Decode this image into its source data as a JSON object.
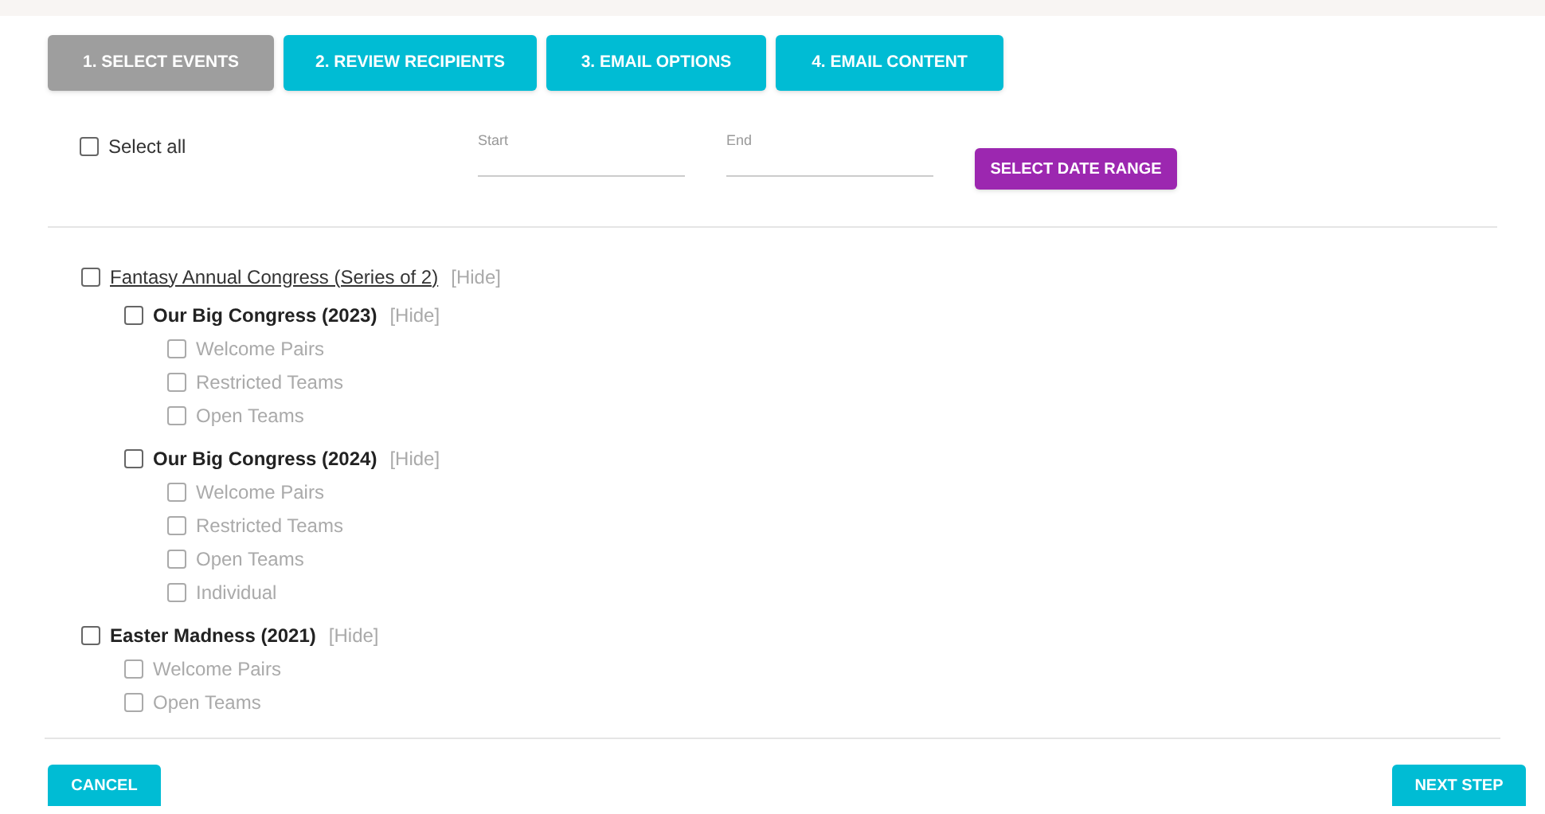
{
  "tabs": [
    {
      "label": "1. SELECT EVENTS",
      "selected": true
    },
    {
      "label": "2. REVIEW RECIPIENTS",
      "selected": false
    },
    {
      "label": "3. EMAIL OPTIONS",
      "selected": false
    },
    {
      "label": "4. EMAIL CONTENT",
      "selected": false
    }
  ],
  "select_all": {
    "label": "Select all",
    "checked": false
  },
  "date_fields": [
    {
      "placeholder": "Start"
    },
    {
      "placeholder": "End"
    }
  ],
  "date_range_button": "SELECT DATE RANGE",
  "events": [
    {
      "kind": "series",
      "label": "Fantasy Annual Congress (Series of 2)",
      "checked": false,
      "hide": "[Hide]",
      "children": [
        {
          "kind": "event",
          "label": "Our Big Congress (2023)",
          "checked": false,
          "hide": "[Hide]",
          "children": [
            {
              "kind": "session",
              "label": "Welcome Pairs",
              "checked": false
            },
            {
              "kind": "session",
              "label": "Restricted Teams",
              "checked": false
            },
            {
              "kind": "session",
              "label": "Open Teams",
              "checked": false
            }
          ]
        },
        {
          "kind": "event",
          "label": "Our Big Congress (2024)",
          "checked": false,
          "hide": "[Hide]",
          "children": [
            {
              "kind": "session",
              "label": "Welcome Pairs",
              "checked": false
            },
            {
              "kind": "session",
              "label": "Restricted Teams",
              "checked": false
            },
            {
              "kind": "session",
              "label": "Open Teams",
              "checked": false
            },
            {
              "kind": "session",
              "label": "Individual",
              "checked": false
            }
          ]
        }
      ]
    },
    {
      "kind": "event",
      "label": "Easter Madness (2021)",
      "checked": false,
      "hide": "[Hide]",
      "children": [
        {
          "kind": "session",
          "label": "Welcome Pairs",
          "checked": false
        },
        {
          "kind": "session",
          "label": "Open Teams",
          "checked": false
        }
      ]
    }
  ],
  "buttons": {
    "cancel": "CANCEL",
    "next": "NEXT STEP"
  }
}
